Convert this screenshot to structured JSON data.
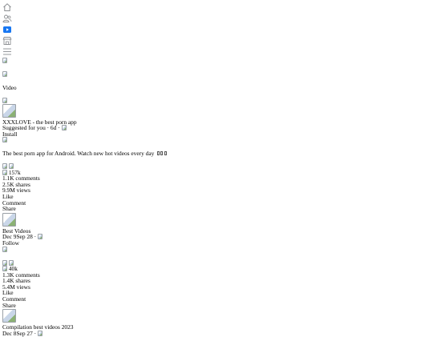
{
  "nav": {
    "items": [
      {
        "icon": "home-icon"
      },
      {
        "icon": "friends-icon"
      },
      {
        "icon": "video-icon",
        "accent": "#1877f2"
      },
      {
        "icon": "marketplace-icon"
      },
      {
        "icon": "menu-icon"
      }
    ]
  },
  "section": {
    "title": "Video"
  },
  "ad": {
    "name": "XXXLOVE - the best porn app",
    "meta": "Suggested for you · 6d ·",
    "install_label": "Install",
    "body": "The best porn app for Android. Watch new hot videos every day",
    "reactions_count": "157k",
    "comments": "1.1K comments",
    "shares": "2.5K shares",
    "views": "9.9M views",
    "like_label": "Like",
    "comment_label": "Comment",
    "share_label": "Share"
  },
  "posts": [
    {
      "author": "Best Videos",
      "date": "Dec 9Sep 28 ·",
      "follow_label": "Follow",
      "reactions_count": "40k",
      "comments": "1.3K comments",
      "shares": "1.4K shares",
      "views": "5.4M views",
      "like_label": "Like",
      "comment_label": "Comment",
      "share_label": "Share"
    },
    {
      "author": "Compilation best videos 2023",
      "date": "Dec 8Sep 27 ·"
    }
  ]
}
